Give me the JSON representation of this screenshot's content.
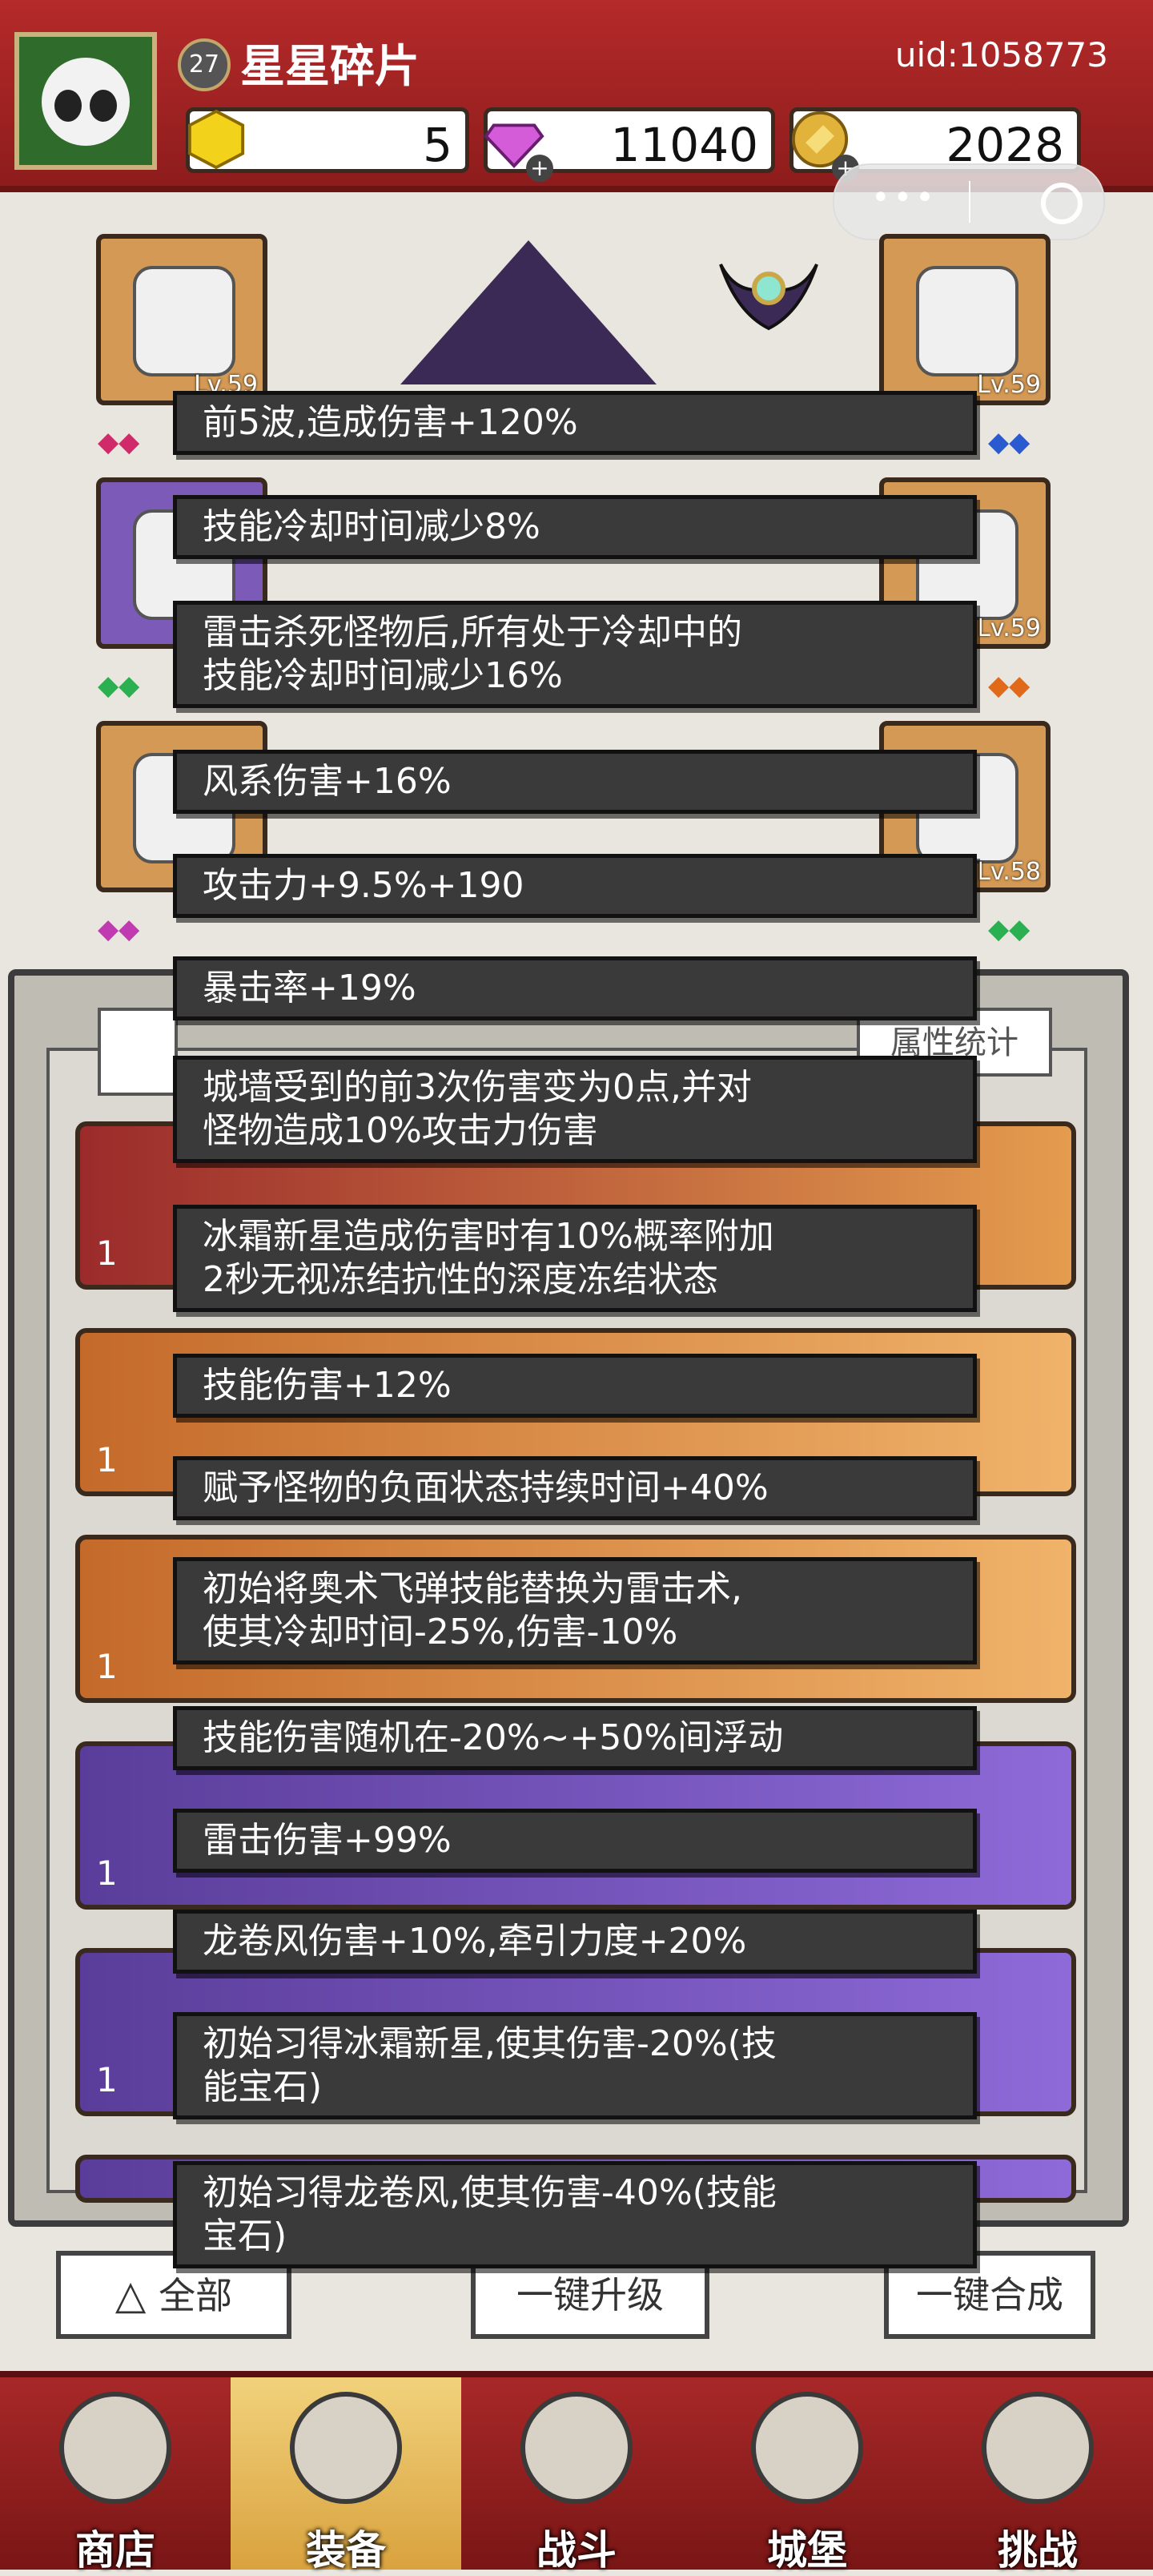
{
  "header": {
    "level": "27",
    "player_name": "星星碎片",
    "uid": "uid:1058773",
    "gold_gem": "5",
    "diamond": "11040",
    "coin": "2028"
  },
  "equipment_slots": [
    {
      "level": "Lv.59"
    },
    {
      "level": "Lv.59"
    },
    {
      "level": "Lv.59"
    },
    {
      "level": "Lv.58"
    }
  ],
  "tooltip": {
    "lines": [
      "前5波,造成伤害+120%",
      "技能冷却时间减少8%",
      "雷击杀死怪物后,所有处于冷却中的\n技能冷却时间减少16%",
      "风系伤害+16%",
      "攻击力+9.5%+190",
      "暴击率+19%",
      "城墙受到的前3次伤害变为0点,并对\n怪物造成10%攻击力伤害",
      "冰霜新星造成伤害时有10%概率附加\n2秒无视冻结抗性的深度冻结状态",
      "技能伤害+12%",
      "赋予怪物的负面状态持续时间+40%",
      "初始将奥术飞弹技能替换为雷击术,\n使其冷却时间-25%,伤害-10%",
      "技能伤害随机在-20%~+50%间浮动",
      "雷击伤害+99%",
      "龙卷风伤害+10%,牵引力度+20%",
      "初始习得冰霜新星,使其伤害-20%(技\n能宝石)",
      "初始习得龙卷风,使其伤害-40%(技能\n宝石)"
    ]
  },
  "inventory": {
    "stat_button": "属性统计",
    "count_label": "1"
  },
  "actions": {
    "filter_all": "全部",
    "upgrade_all": "一键升级",
    "merge_all": "一键合成"
  },
  "nav": [
    {
      "label": "商店"
    },
    {
      "label": "装备"
    },
    {
      "label": "战斗"
    },
    {
      "label": "城堡"
    },
    {
      "label": "挑战"
    }
  ]
}
